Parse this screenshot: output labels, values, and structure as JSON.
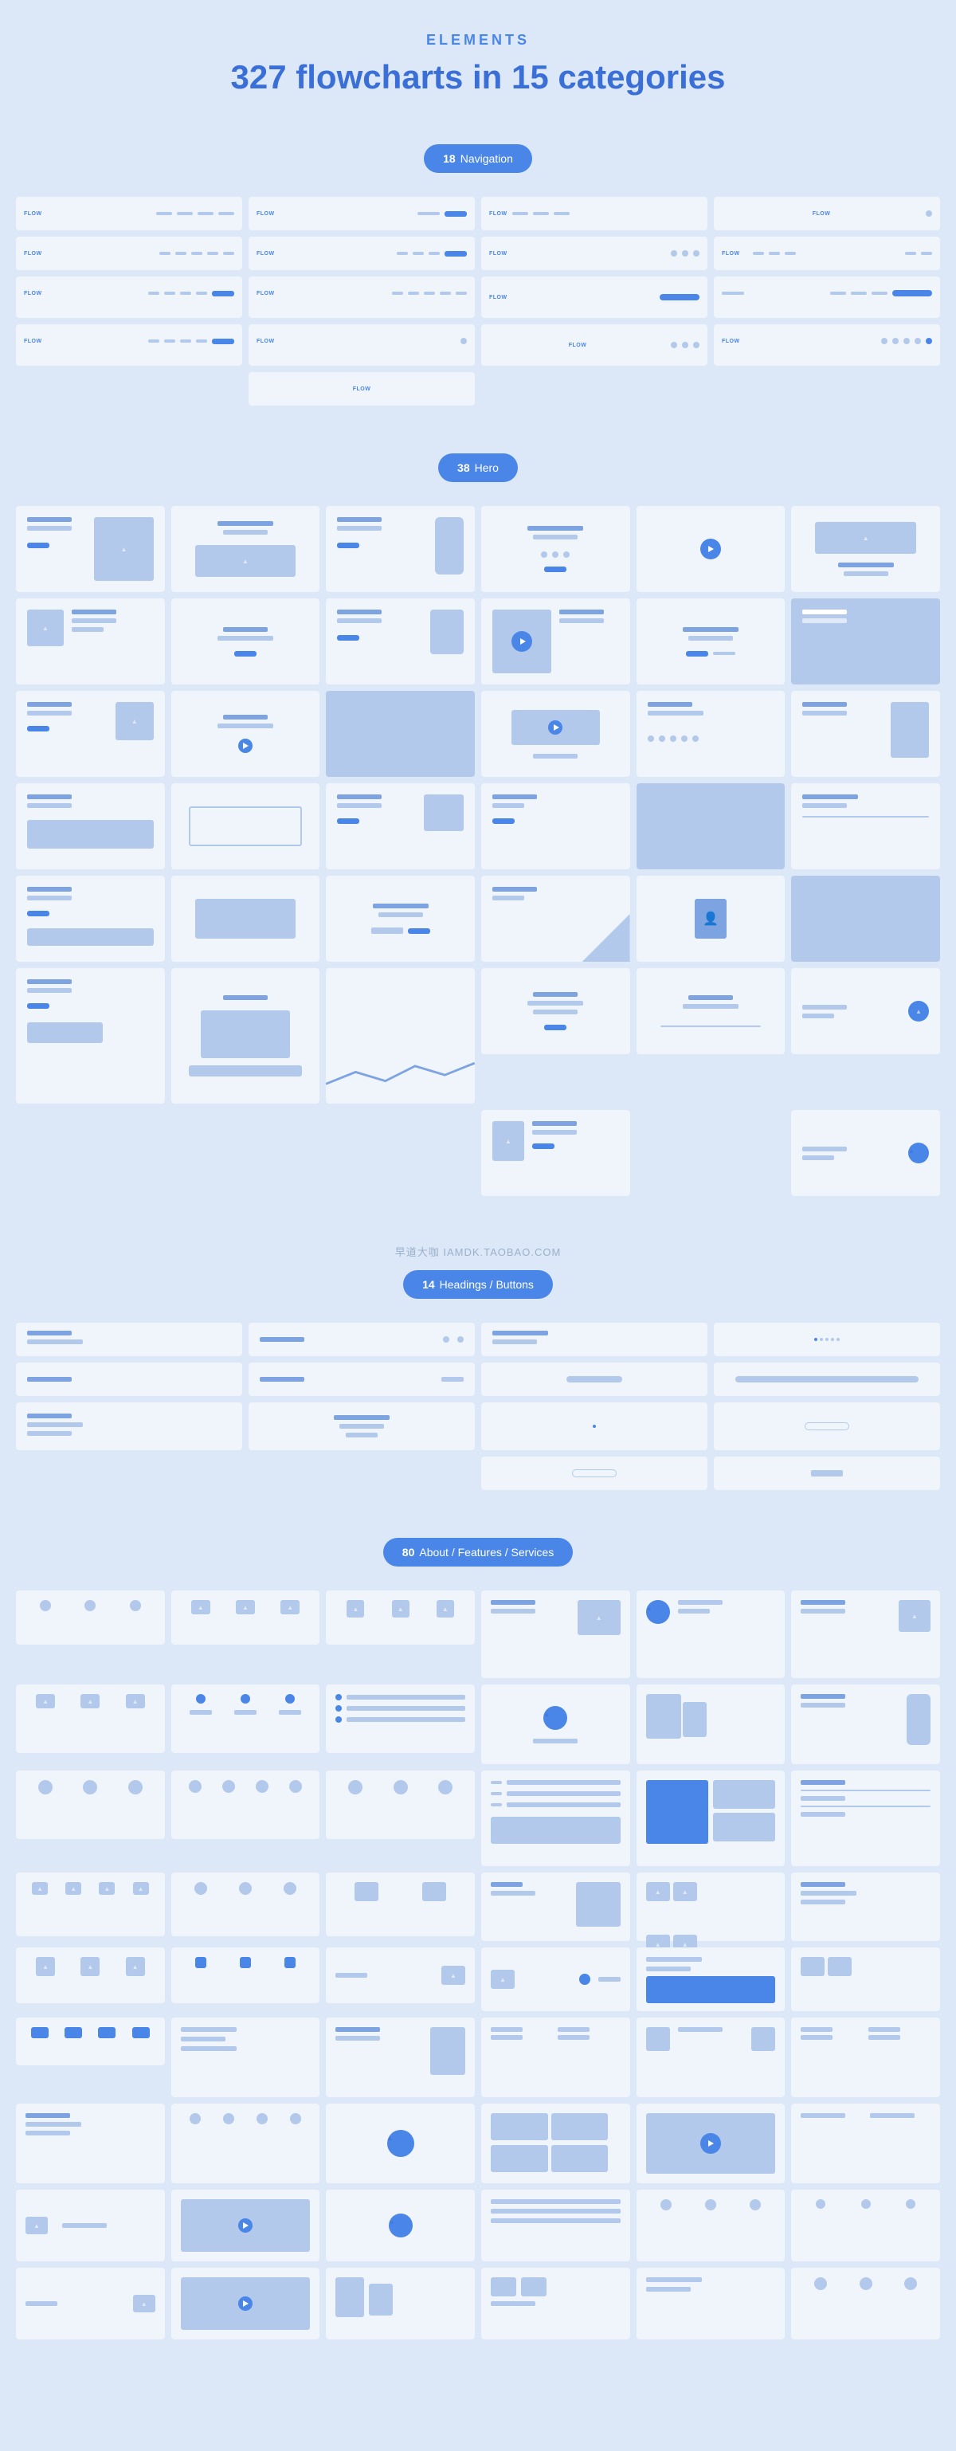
{
  "eyebrow": "ELEMENTS",
  "title": "327 flowcharts in 15 categories",
  "logo": "FLOW",
  "watermark": "早道大咖  IAMDK.TAOBAO.COM",
  "cats": [
    {
      "count": "18",
      "label": "Navigation"
    },
    {
      "count": "38",
      "label": "Hero"
    },
    {
      "count": "14",
      "label": "Headings / Buttons"
    },
    {
      "count": "80",
      "label": "About / Features / Services"
    }
  ]
}
